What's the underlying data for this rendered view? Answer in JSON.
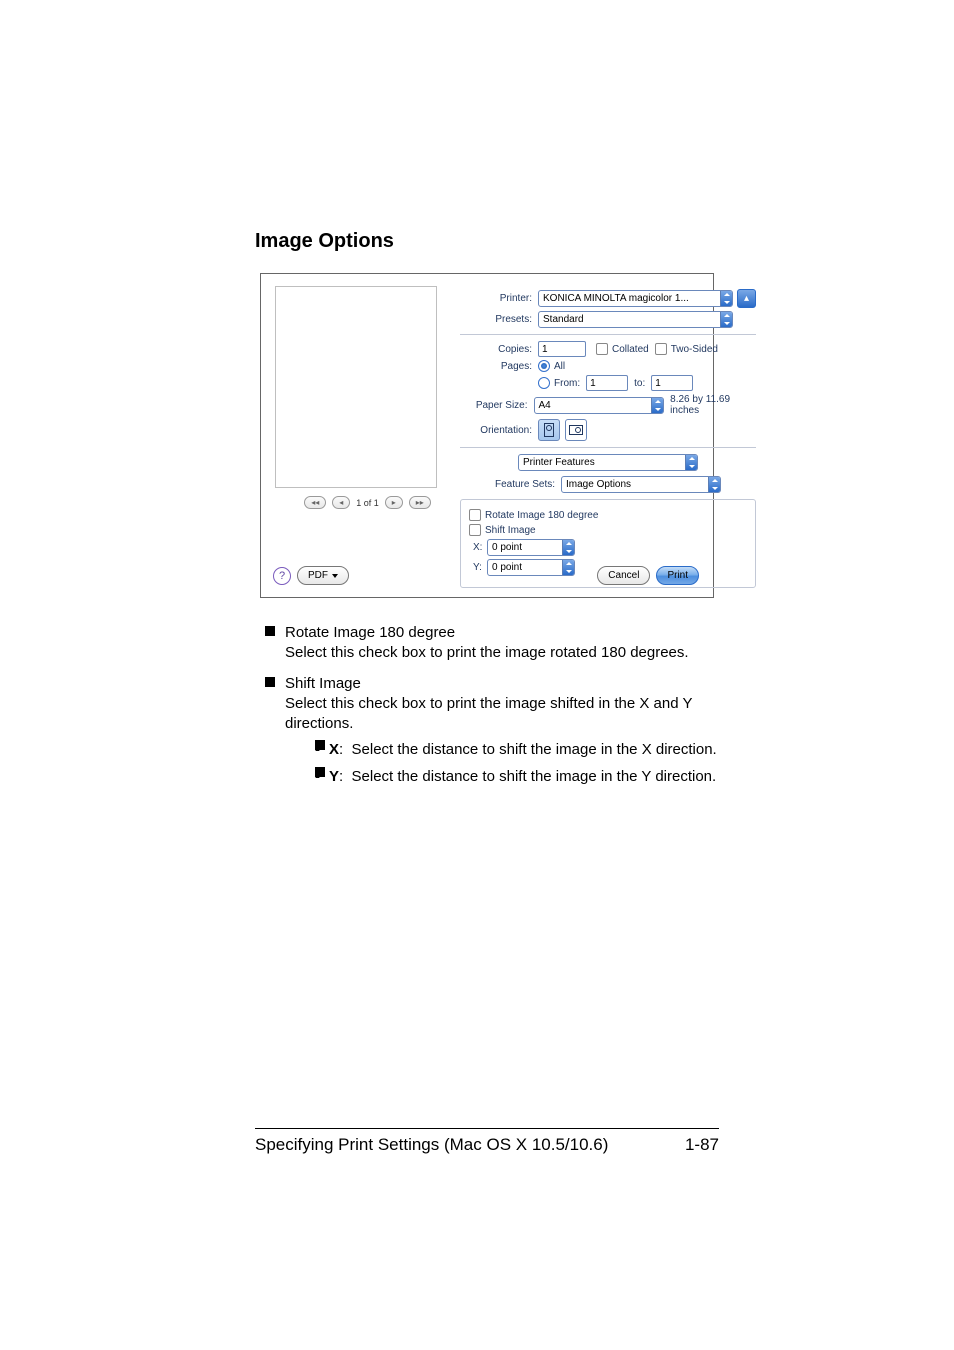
{
  "heading": "Image Options",
  "dialog": {
    "printer_label": "Printer:",
    "printer_value": "KONICA MINOLTA magicolor 1...",
    "presets_label": "Presets:",
    "presets_value": "Standard",
    "copies_label": "Copies:",
    "copies_value": "1",
    "collated_label": "Collated",
    "two_sided_label": "Two-Sided",
    "pages_label": "Pages:",
    "pages_all_label": "All",
    "pages_from_label": "From:",
    "pages_from_value": "1",
    "pages_to_label": "to:",
    "pages_to_value": "1",
    "paper_size_label": "Paper Size:",
    "paper_size_value": "A4",
    "paper_size_dims": "8.26 by 11.69 inches",
    "orientation_label": "Orientation:",
    "pane_value": "Printer Features",
    "feature_sets_label": "Feature Sets:",
    "feature_sets_value": "Image Options",
    "rotate_label": "Rotate Image 180 degree",
    "shift_label": "Shift Image",
    "x_label": "X:",
    "x_value": "0 point",
    "y_label": "Y:",
    "y_value": "0 point",
    "preview_count": "1 of 1",
    "pdf_label": "PDF",
    "cancel_label": "Cancel",
    "print_label": "Print"
  },
  "desc": {
    "rotate_title": "Rotate Image 180 degree",
    "rotate_text": "Select this check box to print the image rotated 180 degrees.",
    "shift_title": "Shift Image",
    "shift_text": "Select this check box to print the image shifted in the X and Y directions.",
    "x_title": "X",
    "x_text": ":  Select the distance to shift the image in the X direction.",
    "y_title": "Y",
    "y_text": ":  Select the distance to shift the image in the Y direction."
  },
  "footer": {
    "title": "Specifying Print Settings (Mac OS X 10.5/10.6)",
    "page": "1-87"
  }
}
